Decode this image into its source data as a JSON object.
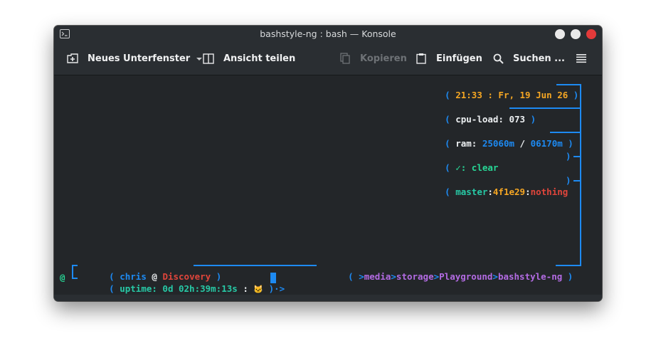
{
  "window": {
    "title": "bashstyle-ng : bash — Konsole"
  },
  "toolbar": {
    "new_tab_label": "Neues Unterfenster",
    "split_view_label": "Ansicht teilen",
    "copy_label": "Kopieren",
    "paste_label": "Einfügen",
    "search_label": "Suchen ..."
  },
  "terminal": {
    "clock": {
      "open": "(",
      "text": "21:33 : Fr, 19 Jun 26",
      "close": ")"
    },
    "cpu": {
      "open": "(",
      "label": "cpu-load:",
      "value": "073",
      "close": ")"
    },
    "ram": {
      "open": "(",
      "label": "ram:",
      "used": "25060m",
      "sep": "/",
      "free": "06170m",
      "close": ")"
    },
    "status": {
      "open": "(",
      "text": "✓: clear",
      "close": ")"
    },
    "git": {
      "open": "(",
      "branch": "master",
      "c1": ":",
      "hash": "4f1e29",
      "c2": ":",
      "state": "nothing",
      "close": ")"
    },
    "prompt1": {
      "corner": "┌─",
      "open": "(",
      "user": "chris",
      "at": "@",
      "host": "Discovery",
      "close": ")",
      "path_open": "(",
      "path": [
        ">",
        "media",
        ">",
        "storage",
        ">",
        "Playground",
        ">",
        "bashstyle-ng"
      ],
      "path_close": ")"
    },
    "prompt2": {
      "at": "@",
      "corner": "└─",
      "open": "(",
      "uptime": "uptime: 0d 02h:39m:13s",
      "colon": ":",
      "emoji": "🐱",
      "close": ")·>"
    }
  },
  "colors": {
    "accent_blue": "#1d8af2",
    "orange": "#f5a623",
    "green": "#27d796",
    "red": "#e0453b",
    "purple": "#b36be3",
    "close_button": "#e33a3a"
  }
}
